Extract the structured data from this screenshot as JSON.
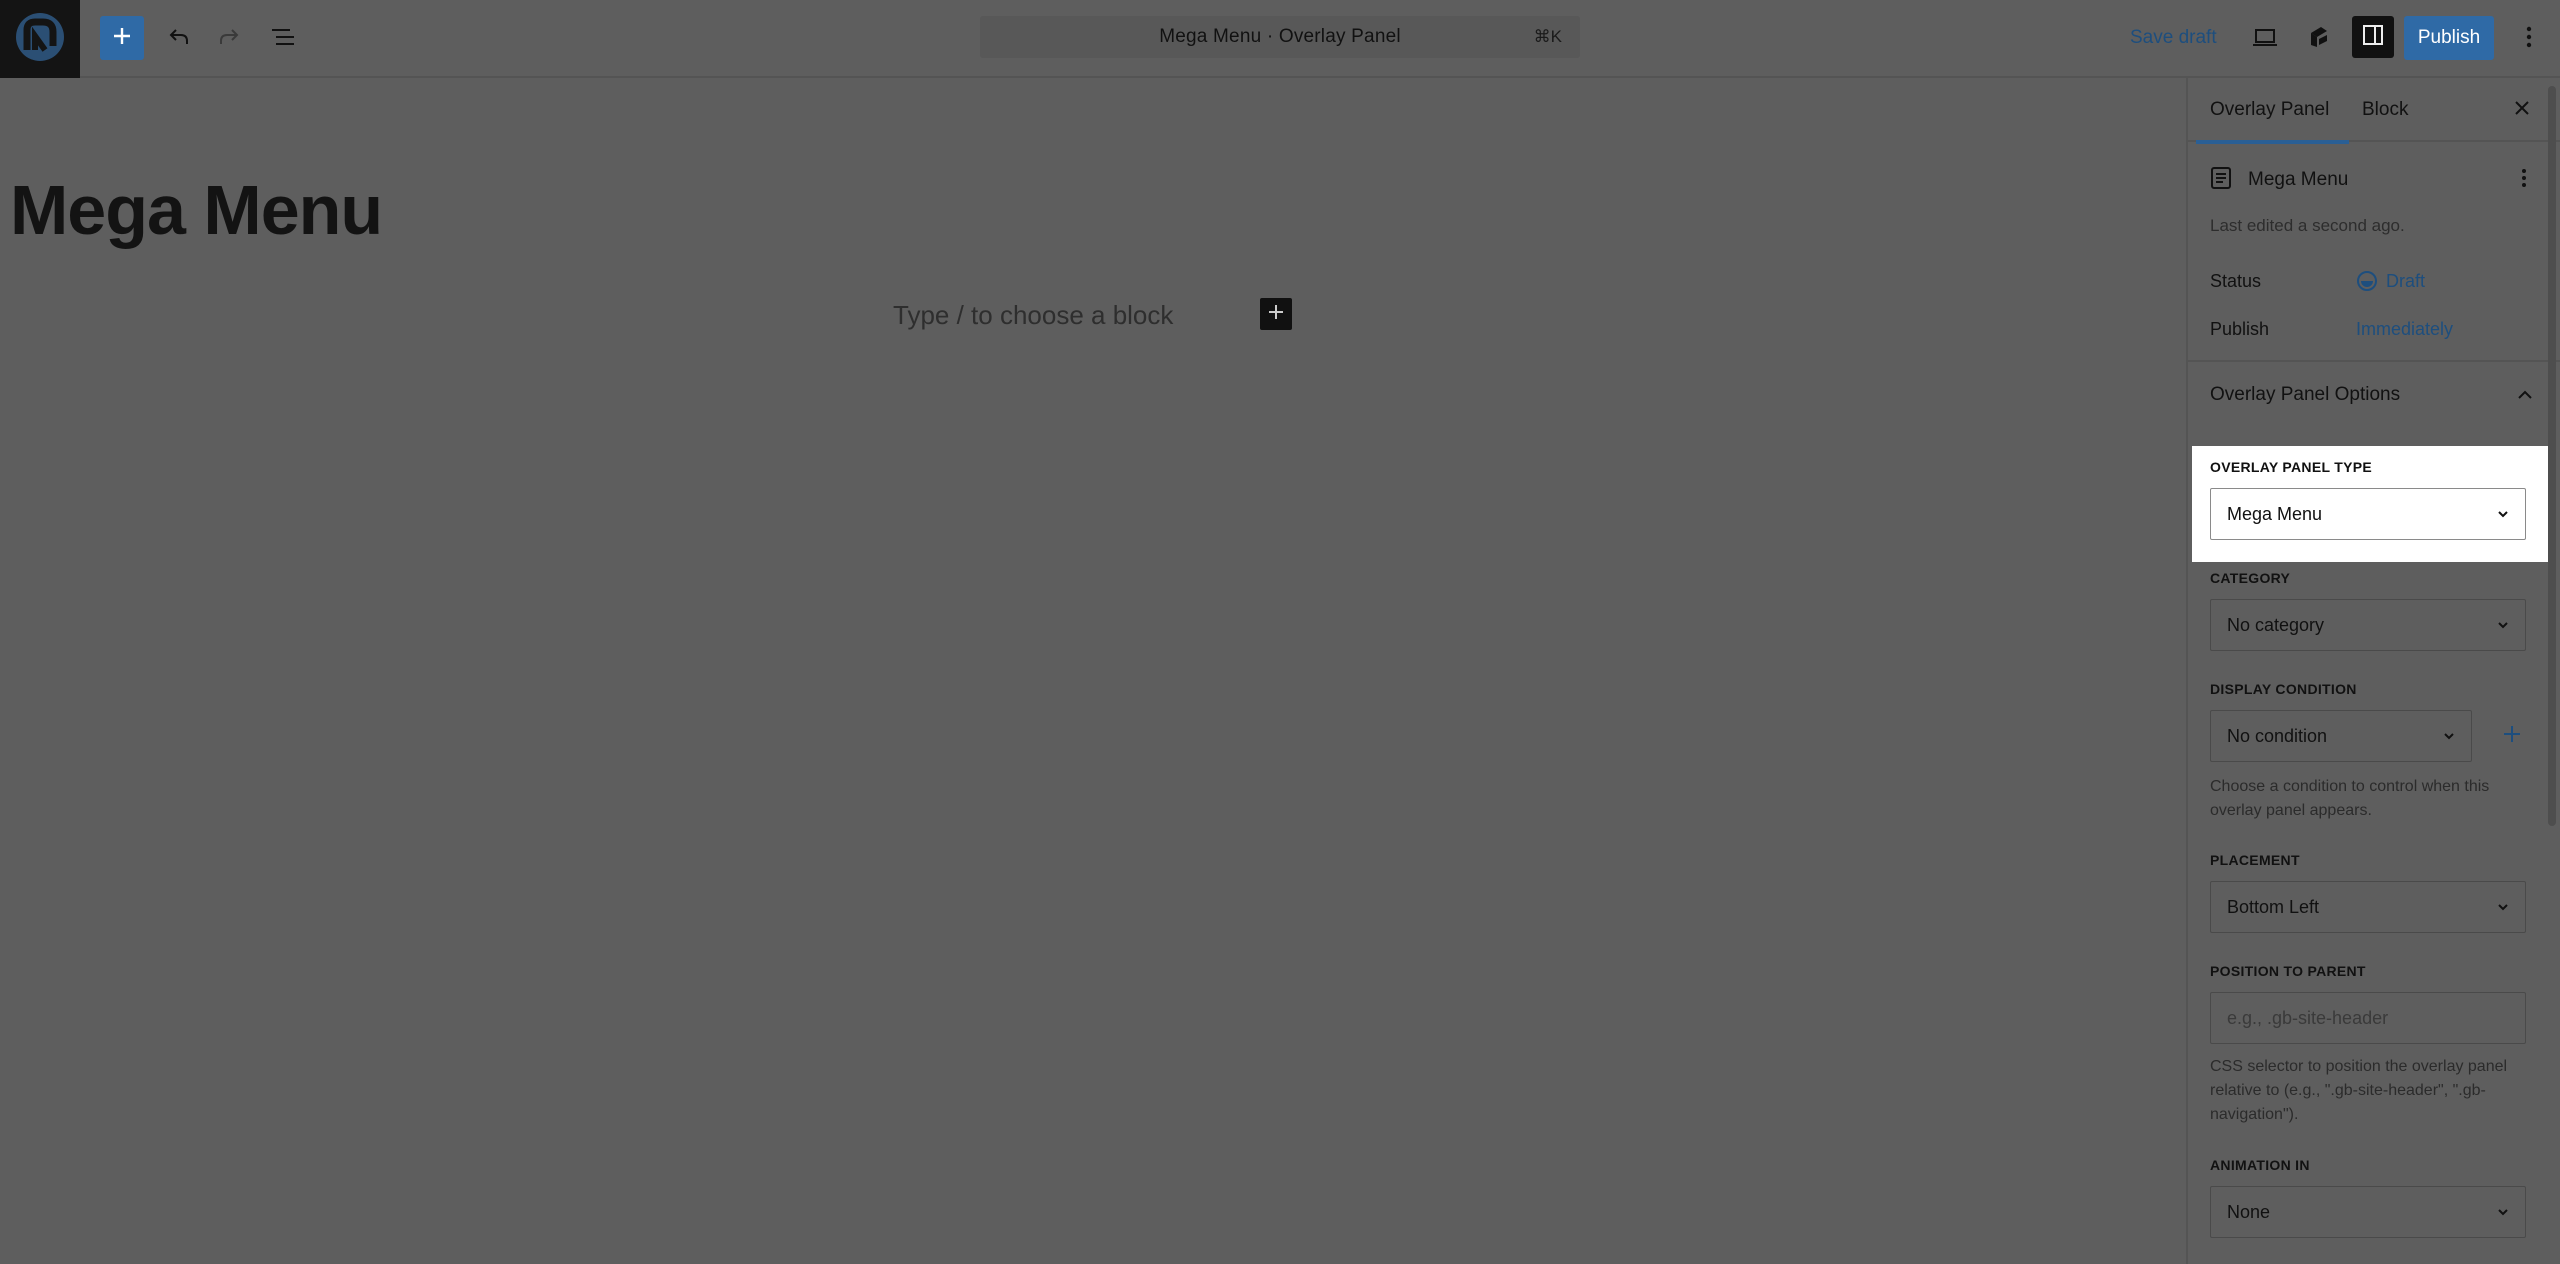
{
  "header": {
    "document_title": "Mega Menu · Overlay Panel",
    "shortcut": "⌘K",
    "save_draft_label": "Save draft",
    "publish_label": "Publish"
  },
  "canvas": {
    "post_title": "Mega Menu",
    "block_placeholder": "Type / to choose a block"
  },
  "sidebar": {
    "tabs": [
      {
        "label": "Overlay Panel",
        "active": true
      },
      {
        "label": "Block",
        "active": false
      }
    ],
    "document": {
      "title": "Mega Menu",
      "last_edited": "Last edited a second ago."
    },
    "status": {
      "label": "Status",
      "value": "Draft"
    },
    "publish": {
      "label": "Publish",
      "value": "Immediately"
    },
    "options_panel": {
      "title": "Overlay Panel Options",
      "overlay_panel_type": {
        "label": "OVERLAY PANEL TYPE",
        "value": "Mega Menu"
      },
      "category": {
        "label": "CATEGORY",
        "value": "No category"
      },
      "display_condition": {
        "label": "DISPLAY CONDITION",
        "value": "No condition",
        "help": "Choose a condition to control when this overlay panel appears."
      },
      "placement": {
        "label": "PLACEMENT",
        "value": "Bottom Left"
      },
      "position_to_parent": {
        "label": "POSITION TO PARENT",
        "placeholder": "e.g., .gb-site-header",
        "help": "CSS selector to position the overlay panel relative to (e.g., \".gb-site-header\", \".gb-navigation\")."
      },
      "animation_in": {
        "label": "ANIMATION IN",
        "value": "None"
      }
    }
  },
  "colors": {
    "accent": "#2f6aa6",
    "link": "#1d4e7e",
    "overlay_bg": "#5e5e5e"
  }
}
